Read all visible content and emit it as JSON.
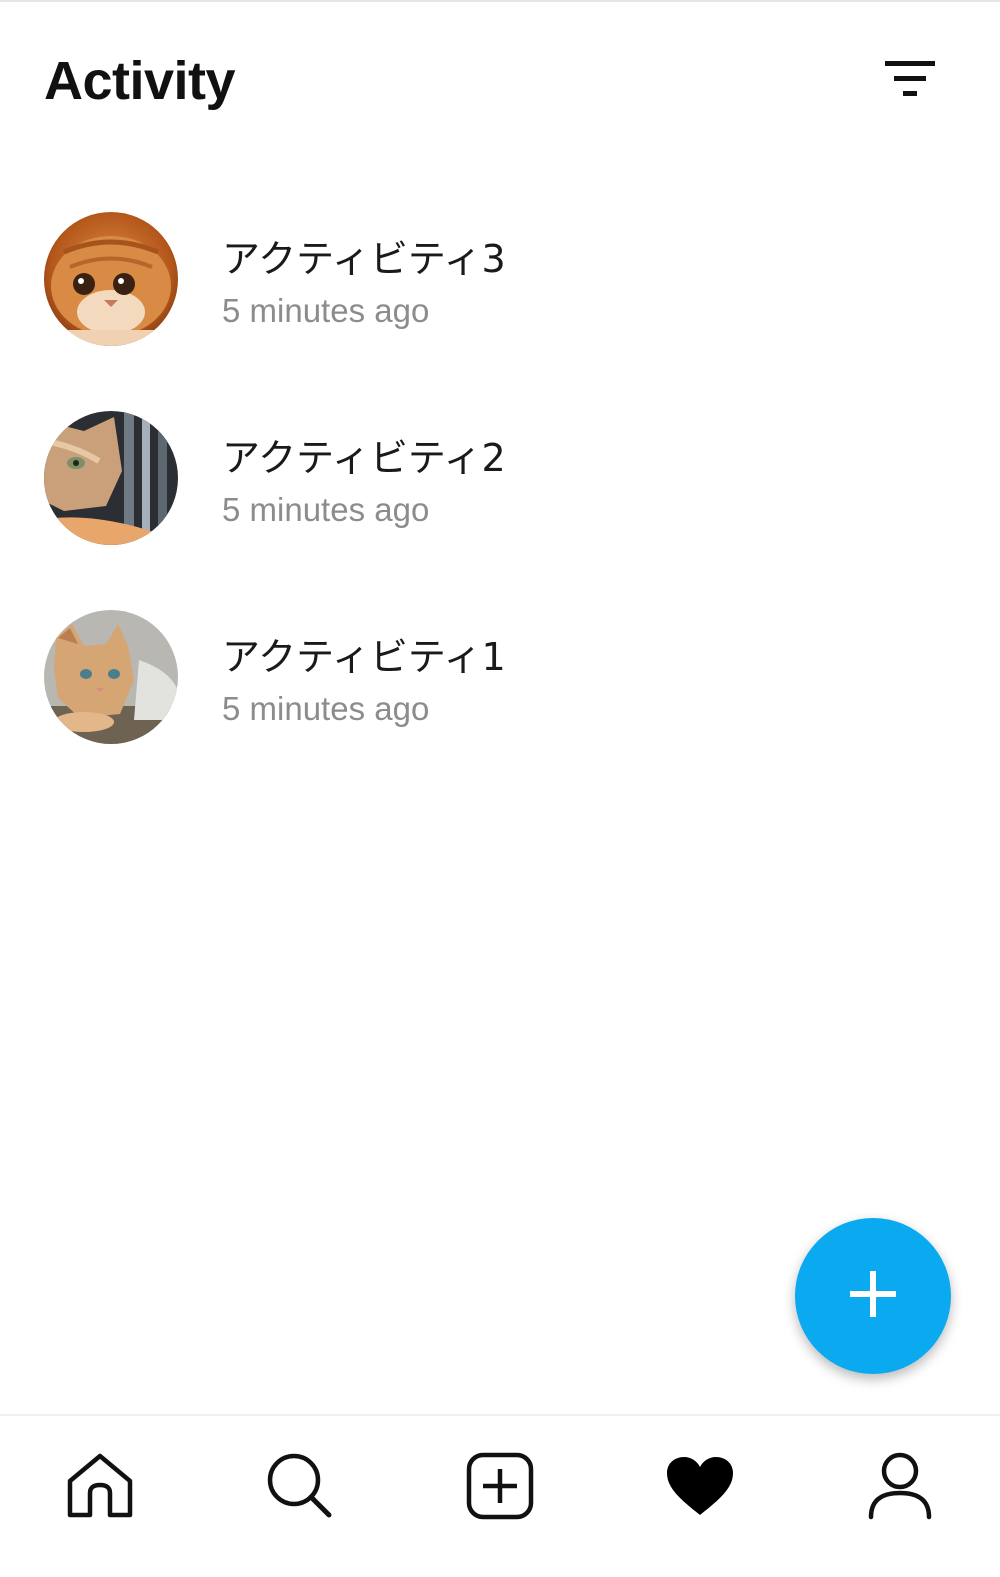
{
  "header": {
    "title": "Activity",
    "filter_icon": "filter-icon"
  },
  "activities": [
    {
      "title": "アクティビティ3",
      "time": "5 minutes ago",
      "avatar": "cat-photo-orange-scottish-fold"
    },
    {
      "title": "アクティビティ2",
      "time": "5 minutes ago",
      "avatar": "cat-photo-ginger-profile"
    },
    {
      "title": "アクティビティ1",
      "time": "5 minutes ago",
      "avatar": "cat-photo-kitten"
    }
  ],
  "fab": {
    "icon": "plus-icon",
    "color": "#0aa9f0"
  },
  "bottom_nav": {
    "items": [
      {
        "icon": "home-icon",
        "active": false
      },
      {
        "icon": "search-icon",
        "active": false
      },
      {
        "icon": "add-post-icon",
        "active": false
      },
      {
        "icon": "heart-icon",
        "active": true
      },
      {
        "icon": "profile-icon",
        "active": false
      }
    ]
  }
}
